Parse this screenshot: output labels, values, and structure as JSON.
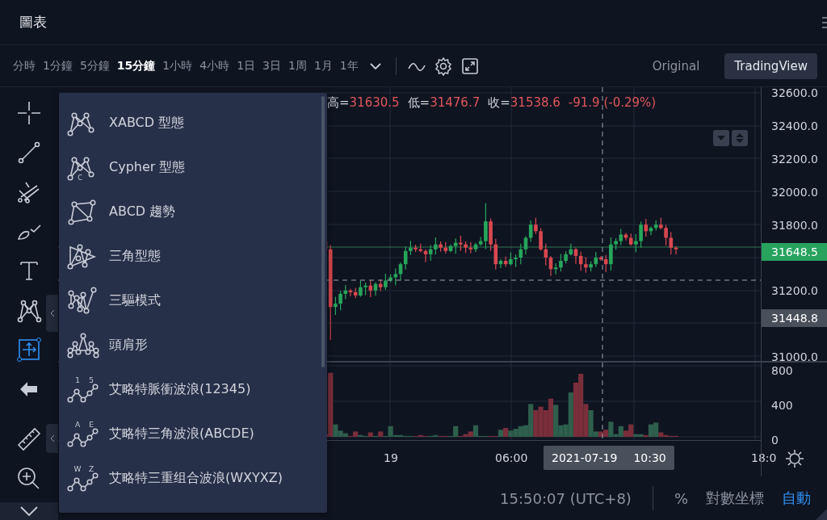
{
  "header": {
    "title": "圖表"
  },
  "intervals": [
    {
      "label": "分時",
      "selected": false
    },
    {
      "label": "1分鐘",
      "selected": false
    },
    {
      "label": "5分鐘",
      "selected": false
    },
    {
      "label": "15分鐘",
      "selected": true
    },
    {
      "label": "1小時",
      "selected": false
    },
    {
      "label": "4小時",
      "selected": false
    },
    {
      "label": "1日",
      "selected": false
    },
    {
      "label": "3日",
      "selected": false
    },
    {
      "label": "1周",
      "selected": false
    },
    {
      "label": "1月",
      "selected": false
    },
    {
      "label": "1年",
      "selected": false
    }
  ],
  "view_modes": [
    {
      "label": "Original",
      "selected": false
    },
    {
      "label": "TradingView",
      "selected": true
    }
  ],
  "tools": [
    {
      "kind": "crosshair",
      "selected": false
    },
    {
      "kind": "line",
      "selected": false
    },
    {
      "kind": "pitchfork",
      "selected": false
    },
    {
      "kind": "brush",
      "selected": false
    },
    {
      "kind": "text",
      "selected": false
    },
    {
      "kind": "pattern",
      "selected": false
    },
    {
      "kind": "measure",
      "selected": true
    },
    {
      "kind": "arrow",
      "selected": false
    },
    {
      "kind": "ruler",
      "selected": false
    },
    {
      "kind": "zoom",
      "selected": false
    }
  ],
  "pattern_menu": [
    {
      "kind": "xabcd",
      "label": "XABCD 型態"
    },
    {
      "kind": "cypher",
      "label": "Cypher 型態",
      "icon_text": [
        "C"
      ]
    },
    {
      "kind": "abcd",
      "label": "ABCD 趨勢"
    },
    {
      "kind": "triangle",
      "label": "三角型態"
    },
    {
      "kind": "three_drives",
      "label": "三驅模式"
    },
    {
      "kind": "head_shoulders",
      "label": "頭肩形"
    },
    {
      "kind": "wave",
      "label": "艾略特脈衝波浪(12345)",
      "icon_text": [
        "1",
        "5"
      ]
    },
    {
      "kind": "wave",
      "label": "艾略特三角波浪(ABCDE)",
      "icon_text": [
        "A",
        "E"
      ]
    },
    {
      "kind": "wave",
      "label": "艾略特三重组合波浪(WXYXZ)",
      "icon_text": [
        "W",
        "Z"
      ]
    }
  ],
  "legend": {
    "fields": [
      {
        "label": "高=",
        "value": "31630.5"
      },
      {
        "label": "低=",
        "value": "31476.7"
      },
      {
        "label": "收=",
        "value": "31538.6"
      }
    ],
    "change": "-91.9 (-0.29%)"
  },
  "price_axis": {
    "labels": [
      "32600.0",
      "32400.0",
      "32200.0",
      "32000.0",
      "31800.0",
      "31200.0",
      "31000.0"
    ],
    "last_price": "31648.5",
    "cursor_price": "31448.8"
  },
  "volume_axis": {
    "labels": [
      "800",
      "400",
      "0"
    ]
  },
  "time_axis": {
    "labels": [
      "19",
      "06:00",
      "18:0"
    ],
    "cursor_date": "2021-07-19",
    "cursor_time": "10:30"
  },
  "status_bar": {
    "time": "15:50:07 (UTC+8)",
    "percent": "%",
    "log": "對數坐標",
    "auto": "自動",
    "auto_on": true
  }
}
